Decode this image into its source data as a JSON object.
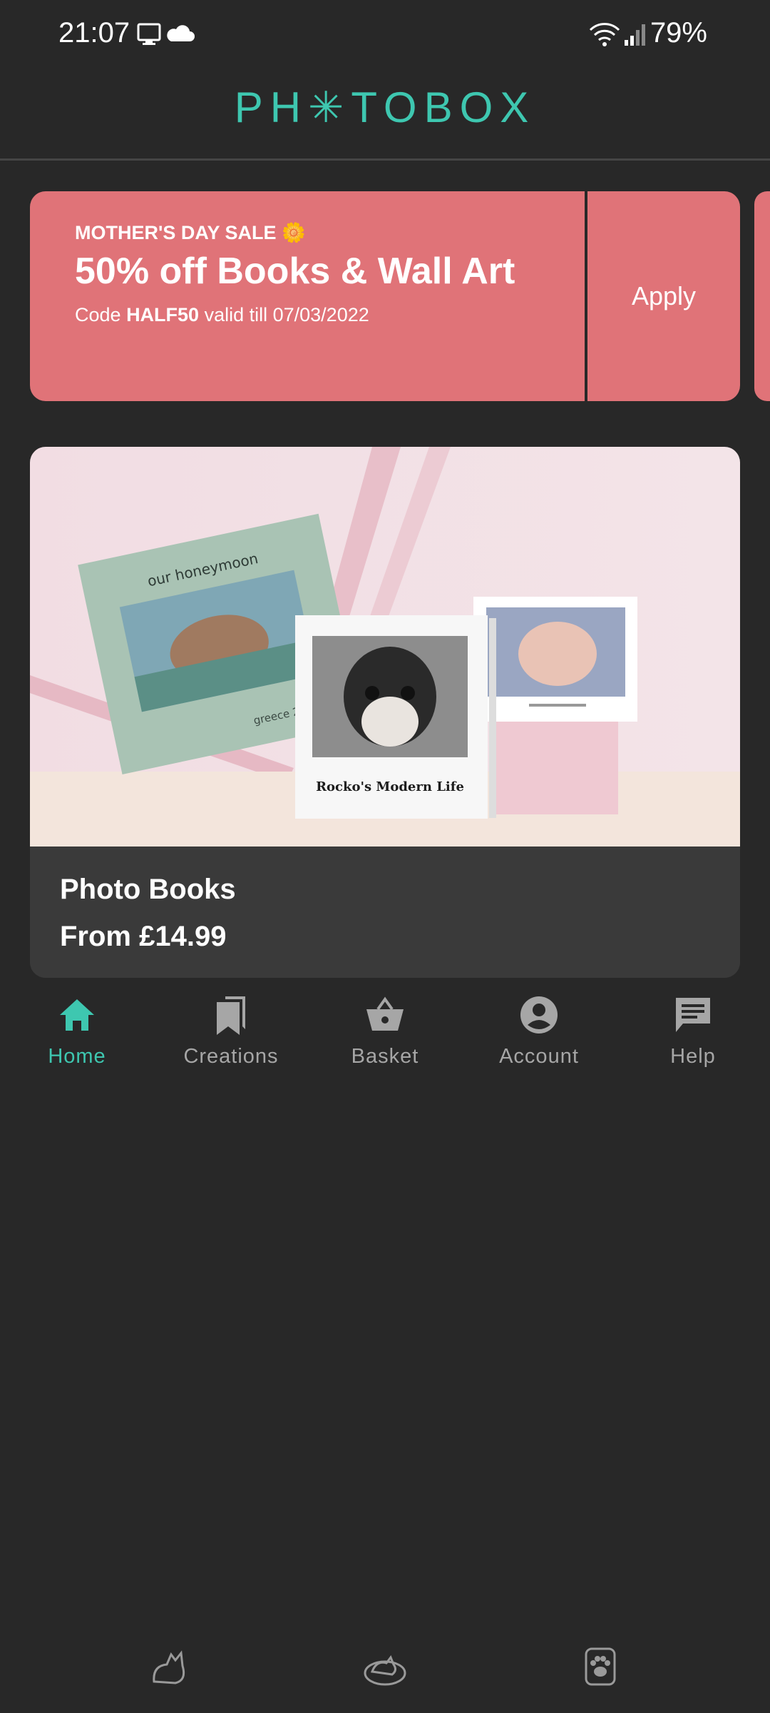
{
  "status": {
    "time": "21:07",
    "battery": "79%",
    "icons": [
      "monitor-icon",
      "cloud-icon",
      "wifi-icon",
      "signal-icon"
    ]
  },
  "header": {
    "logo": "PH✳TOBOX"
  },
  "promo": {
    "sale": "MOTHER'S DAY SALE 🌼",
    "title": "50% off Books & Wall Art",
    "code_prefix": "Code ",
    "code": "HALF50",
    "code_suffix": " valid till 07/03/2022",
    "apply": "Apply",
    "color": "#e07378"
  },
  "product": {
    "title": "Photo Books",
    "price": "From £14.99",
    "book1_title": "our honeymoon",
    "book1_subtitle": "greece 2021",
    "book2_title": "Rocko's Modern Life"
  },
  "nav": {
    "items": [
      {
        "label": "Home",
        "icon": "home-icon",
        "active": true
      },
      {
        "label": "Creations",
        "icon": "bookmarks-icon",
        "active": false
      },
      {
        "label": "Basket",
        "icon": "basket-icon",
        "active": false
      },
      {
        "label": "Account",
        "icon": "account-icon",
        "active": false
      },
      {
        "label": "Help",
        "icon": "chat-help-icon",
        "active": false
      }
    ],
    "accent": "#3ec7b0"
  },
  "system_nav": [
    "back-cat-icon",
    "home-cat-icon",
    "recents-paw-icon"
  ]
}
